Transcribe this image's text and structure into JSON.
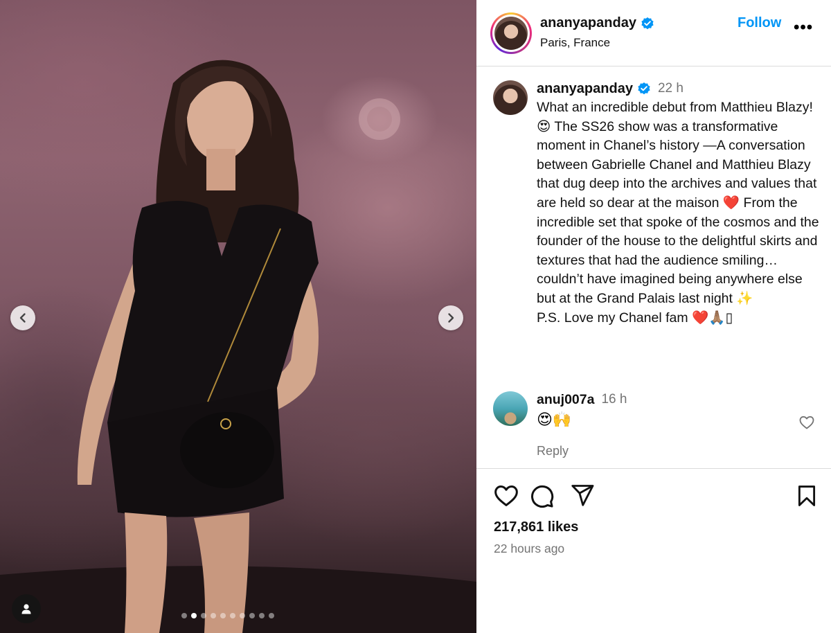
{
  "post": {
    "username": "ananyapanday",
    "location": "Paris, France",
    "follow_label": "Follow",
    "more_label": "•••"
  },
  "caption": {
    "username": "ananyapanday",
    "time": "22 h",
    "text": "What an incredible debut from Matthieu Blazy! 😍 The SS26 show was a transformative moment in Chanel’s history —A conversation between Gabrielle Chanel and Matthieu Blazy that dug deep into the archives and values that are held so dear at the maison ❤️ From the incredible set that spoke of the cosmos and the founder of the house to the delightful skirts and textures that had the audience smiling…couldn’t have imagined being anywhere else but at the Grand Palais last night ✨\nP.S. Love my Chanel fam ❤️🙏🏽▯"
  },
  "comment": {
    "username": "anuj007a",
    "time": "16 h",
    "text": "😍🙌",
    "reply_label": "Reply"
  },
  "stats": {
    "likes": "217,861 likes",
    "posted_ago": "22 hours ago"
  },
  "carousel": {
    "total_slides": 10,
    "active_index": 1
  },
  "colors": {
    "accent": "#0095f6",
    "secondary_text": "#737373",
    "divider": "#dbdbdb"
  },
  "icons": [
    "verified-badge-icon",
    "chevron-left-icon",
    "chevron-right-icon",
    "user-tag-icon",
    "heart-icon",
    "comment-icon",
    "share-icon",
    "bookmark-icon",
    "more-icon"
  ]
}
